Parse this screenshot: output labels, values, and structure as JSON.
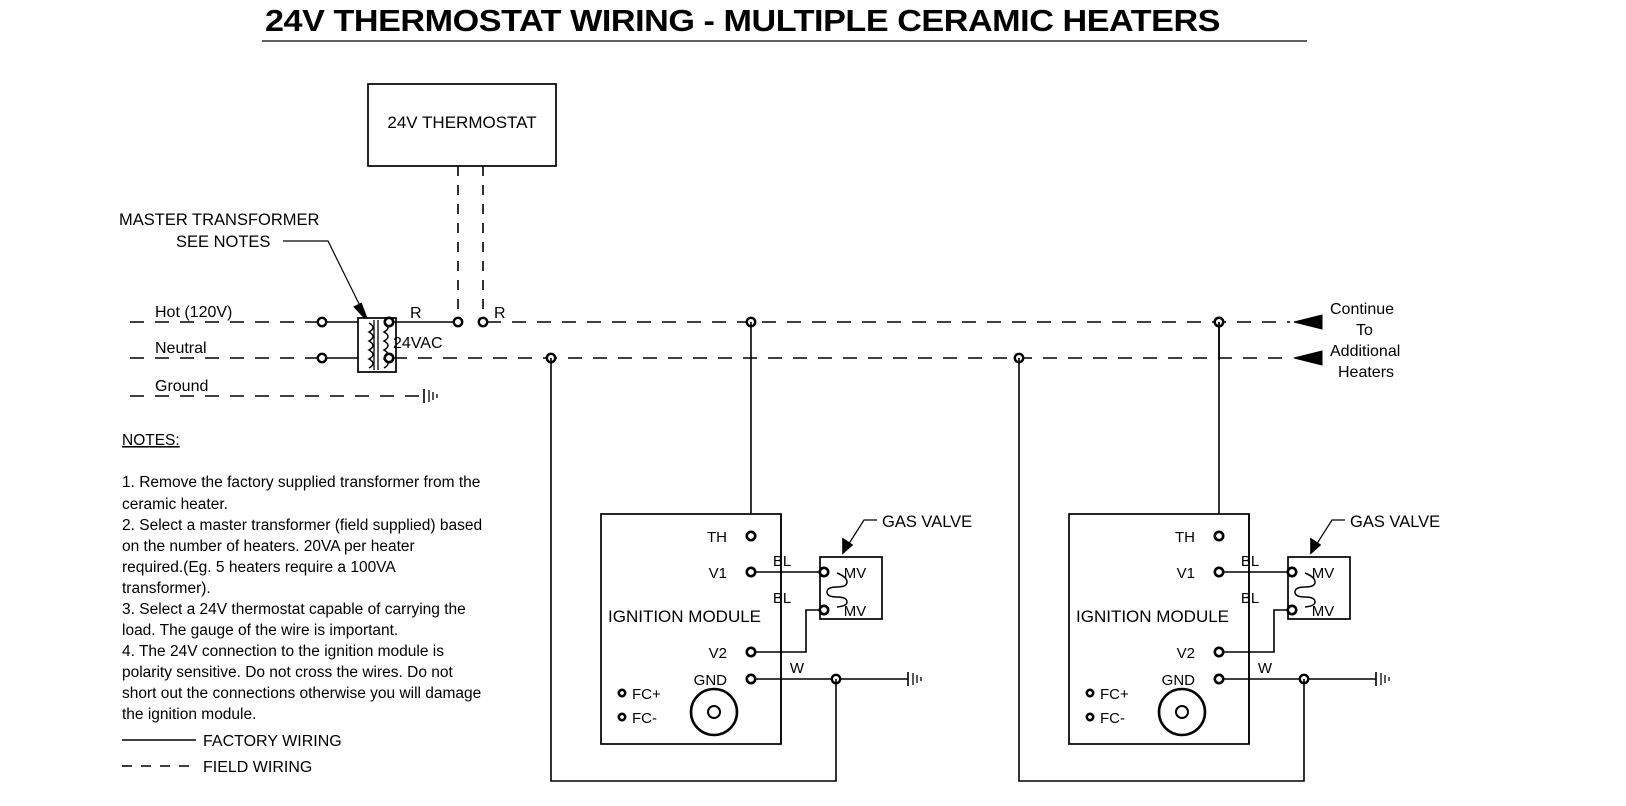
{
  "title": "24V THERMOSTAT WIRING - MULTIPLE CERAMIC HEATERS",
  "thermostat": {
    "label": "24V THERMOSTAT",
    "wire_label_left": "R",
    "wire_label_right": "R"
  },
  "transformer": {
    "callout_line1": "MASTER TRANSFORMER",
    "callout_line2": "SEE NOTES",
    "secondary_label": "24VAC"
  },
  "power": {
    "hot": "Hot (120V)",
    "neutral": "Neutral",
    "ground": "Ground"
  },
  "continue": {
    "line1": "Continue",
    "line2": "To",
    "line3": "Additional",
    "line4": "Heaters"
  },
  "notes": {
    "heading": "NOTES:",
    "items": [
      "1. Remove the factory supplied transformer from the",
      "ceramic heater.",
      "2. Select a master transformer (field supplied) based",
      "on the number of heaters. 20VA per heater",
      "required.(Eg. 5 heaters require a 100VA",
      "transformer).",
      "3. Select a 24V thermostat capable of carrying the",
      "load.  The gauge of the wire is important.",
      "4. The 24V connection to the ignition module is",
      "polarity sensitive.  Do not cross the wires.  Do not",
      "short out the connections otherwise you will damage",
      "the ignition module."
    ]
  },
  "legend": {
    "factory": "FACTORY WIRING",
    "field": "FIELD WIRING"
  },
  "modules": [
    {
      "name": "IGNITION MODULE",
      "terminals": {
        "th": "TH",
        "v1": "V1",
        "v2": "V2",
        "gnd": "GND",
        "fc_plus": "FC+",
        "fc_minus": "FC-"
      },
      "wire_labels": {
        "bl_top": "BL",
        "bl_bottom": "BL",
        "w": "W"
      },
      "gas_valve": {
        "callout": "GAS VALVE",
        "mv_top": "MV",
        "mv_bottom": "MV"
      }
    },
    {
      "name": "IGNITION MODULE",
      "terminals": {
        "th": "TH",
        "v1": "V1",
        "v2": "V2",
        "gnd": "GND",
        "fc_plus": "FC+",
        "fc_minus": "FC-"
      },
      "wire_labels": {
        "bl_top": "BL",
        "bl_bottom": "BL",
        "w": "W"
      },
      "gas_valve": {
        "callout": "GAS VALVE",
        "mv_top": "MV",
        "mv_bottom": "MV"
      }
    }
  ],
  "colors": {
    "line": "#000000",
    "background": "#ffffff"
  }
}
